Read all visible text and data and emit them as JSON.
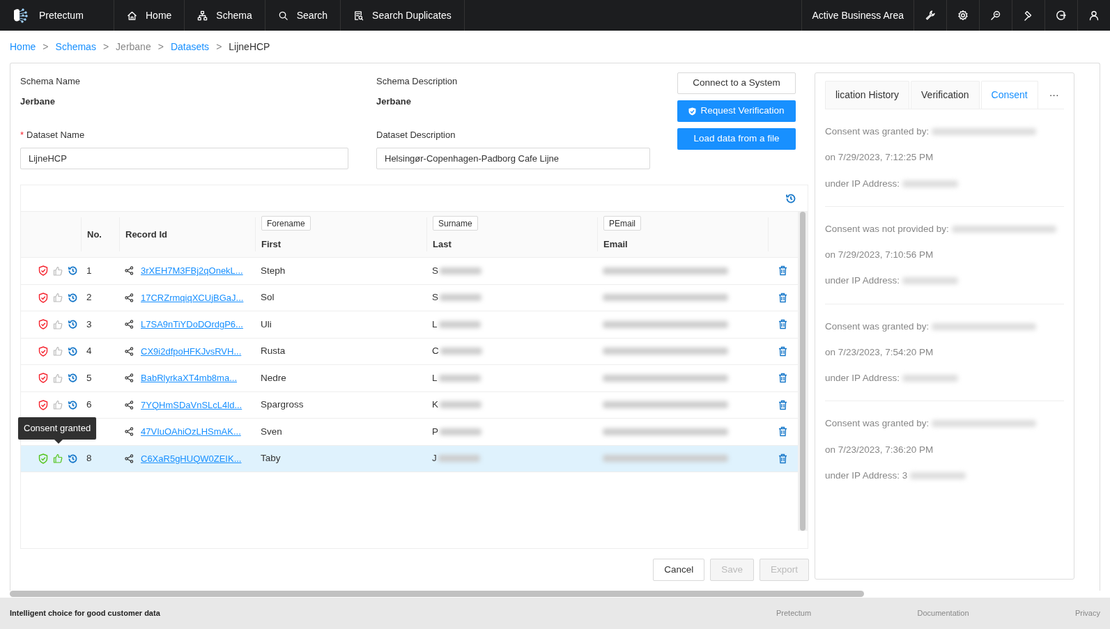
{
  "nav": {
    "brand": "Pretectum",
    "items": [
      {
        "label": "Home"
      },
      {
        "label": "Schema"
      },
      {
        "label": "Search"
      },
      {
        "label": "Search Duplicates"
      }
    ],
    "business_area": "Active Business Area"
  },
  "breadcrumb": {
    "separator": ">",
    "items": [
      {
        "label": "Home",
        "kind": "link"
      },
      {
        "label": "Schemas",
        "kind": "link"
      },
      {
        "label": "Jerbane",
        "kind": "muted"
      },
      {
        "label": "Datasets",
        "kind": "link"
      },
      {
        "label": "LijneHCP",
        "kind": "current"
      }
    ]
  },
  "form": {
    "schema_name": {
      "label": "Schema Name",
      "value": "Jerbane"
    },
    "schema_description": {
      "label": "Schema Description",
      "value": "Jerbane"
    },
    "dataset_name": {
      "label": "Dataset Name",
      "required_mark": "*",
      "value": "LijneHCP"
    },
    "dataset_description": {
      "label": "Dataset Description",
      "value": "Helsingør-Copenhagen-Padborg Cafe Lijne"
    }
  },
  "actions": [
    {
      "label": "Connect to a System",
      "kind": "outline"
    },
    {
      "label": "Request Verification",
      "kind": "primary-shield"
    },
    {
      "label": "Load data from a file",
      "kind": "primary"
    }
  ],
  "table": {
    "columns": [
      {
        "label": "No."
      },
      {
        "label": "Record Id"
      },
      {
        "tag": "Forename",
        "label": "First"
      },
      {
        "tag": "Surname",
        "label": "Last"
      },
      {
        "tag": "PEmail",
        "label": "Email"
      }
    ],
    "rows": [
      {
        "no": "1",
        "record_id": "3rXEH7M3FBj2qOnekL...",
        "first": "Steph",
        "last": "S",
        "consented": false,
        "selected": false
      },
      {
        "no": "2",
        "record_id": "17CRZrmqiqXCUjBGaJ...",
        "first": "Sol",
        "last": "S",
        "consented": false,
        "selected": false
      },
      {
        "no": "3",
        "record_id": "L7SA9nTiYDoDOrdgP6...",
        "first": "Uli",
        "last": "L",
        "consented": false,
        "selected": false
      },
      {
        "no": "4",
        "record_id": "CX9i2dfpoHFKJvsRVH...",
        "first": "Rusta",
        "last": "C",
        "consented": false,
        "selected": false
      },
      {
        "no": "5",
        "record_id": "BabRlyrkaXT4mb8ma...",
        "first": "Nedre",
        "last": "L",
        "consented": false,
        "selected": false
      },
      {
        "no": "6",
        "record_id": "7YQHmSDaVnSLcL4ld...",
        "first": "Spargross",
        "last": "K",
        "consented": false,
        "selected": false
      },
      {
        "record_id": "47VIuOAhiOzLHSmAK...",
        "first": "Sven",
        "last": "P",
        "selected": false
      },
      {
        "no": "8",
        "record_id": "C6XaR5gHUQW0ZEIK...",
        "first": "Taby",
        "last": "J",
        "consented": true,
        "selected": true
      }
    ],
    "tooltip": "Consent granted"
  },
  "footer_buttons": [
    {
      "label": "Cancel",
      "disabled": false
    },
    {
      "label": "Save",
      "disabled": true
    },
    {
      "label": "Export",
      "disabled": true
    }
  ],
  "panel": {
    "tabs": [
      {
        "label": "lication History",
        "selected": false
      },
      {
        "label": "Verification",
        "selected": false
      },
      {
        "label": "Consent",
        "selected": true
      }
    ],
    "more": "···",
    "entries": [
      {
        "statement": "Consent was granted by:",
        "date": "on 7/29/2023, 7:12:25 PM",
        "ip_label": "under IP Address:"
      },
      {
        "statement": "Consent was not provided by:",
        "date": "on 7/29/2023, 7:10:56 PM",
        "ip_label": "under IP Address:"
      },
      {
        "statement": "Consent was granted by:",
        "date": "on 7/23/2023, 7:54:20 PM",
        "ip_label": "under IP Address:"
      },
      {
        "statement": "Consent was granted by:",
        "date": "on 7/23/2023, 7:36:20 PM",
        "ip_label": "under IP Address: 3"
      }
    ]
  },
  "footer": {
    "tagline": "Intelligent choice for good customer data",
    "links": [
      "Pretectum",
      "Documentation",
      "Privacy"
    ]
  }
}
